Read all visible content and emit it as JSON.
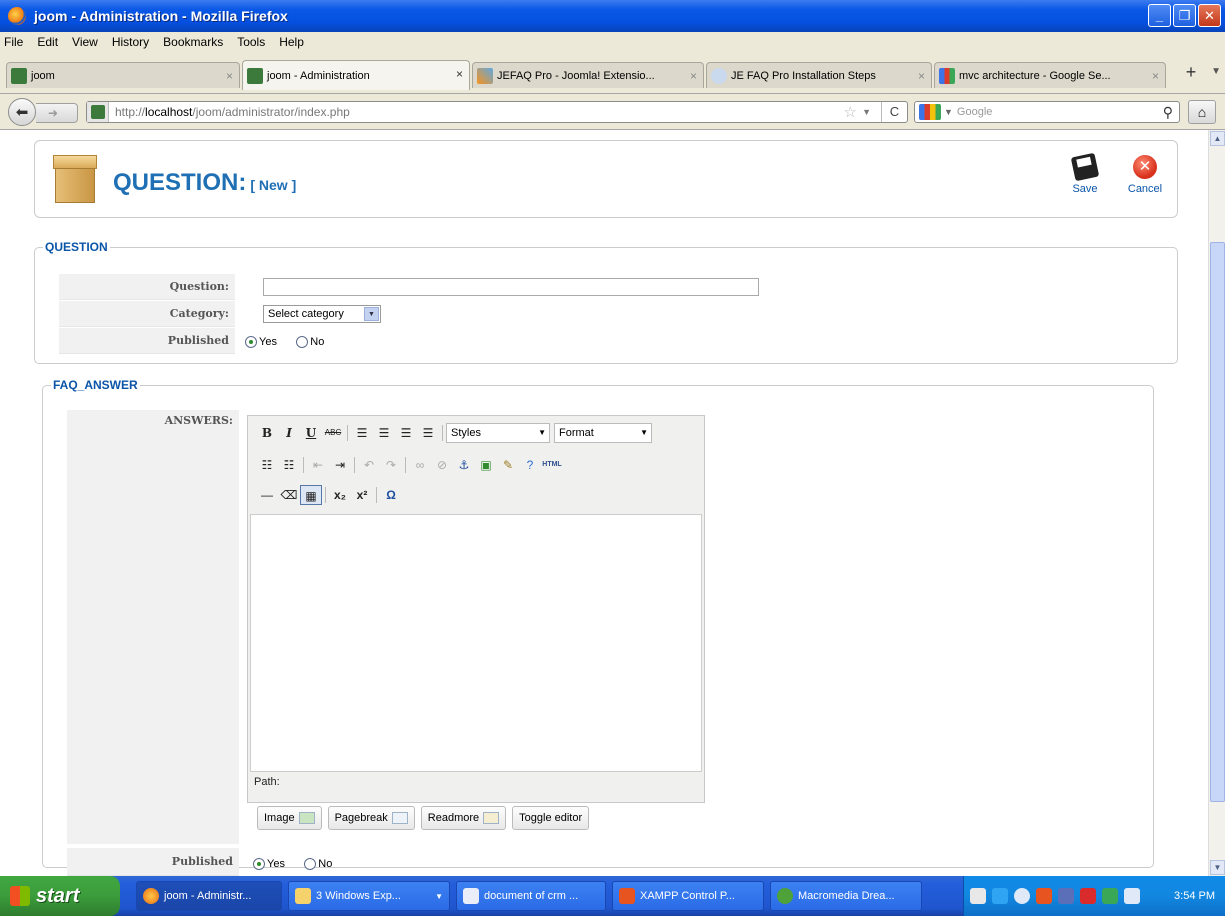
{
  "window": {
    "title": "joom - Administration - Mozilla Firefox"
  },
  "menu": [
    "File",
    "Edit",
    "View",
    "History",
    "Bookmarks",
    "Tools",
    "Help"
  ],
  "tabs": [
    {
      "label": "joom",
      "active": false
    },
    {
      "label": "joom - Administration",
      "active": true
    },
    {
      "label": "JEFAQ Pro - Joomla! Extensio...",
      "active": false
    },
    {
      "label": "JE FAQ Pro Installation Steps",
      "active": false
    },
    {
      "label": "mvc architecture - Google Se...",
      "active": false
    }
  ],
  "nav": {
    "url_prefix": "http://",
    "url_host": "localhost",
    "url_path": "/joom/administrator/index.php",
    "search_placeholder": "Google"
  },
  "page": {
    "title": "QUESTION:",
    "subtitle": "[ New ]",
    "save_label": "Save",
    "cancel_label": "Cancel"
  },
  "question_section": {
    "legend": "QUESTION",
    "question_label": "Question:",
    "question_value": "",
    "category_label": "Category:",
    "category_value": "Select category",
    "published_label": "Published",
    "yes_label": "Yes",
    "no_label": "No",
    "published_value": "Yes"
  },
  "answer_section": {
    "legend": "FAQ_ANSWER",
    "answers_label": "ANSWERS:",
    "styles_label": "Styles",
    "format_label": "Format",
    "html_label": "HTML",
    "path_label": "Path:",
    "buttons": {
      "image": "Image",
      "pagebreak": "Pagebreak",
      "readmore": "Readmore",
      "toggle": "Toggle editor"
    },
    "published_label": "Published",
    "yes_label": "Yes",
    "no_label": "No",
    "published_value": "Yes"
  },
  "taskbar": {
    "start_label": "start",
    "tasks": [
      "joom - Administr...",
      "3 Windows Exp...",
      "document of crm ...",
      "XAMPP Control P...",
      "Macromedia Drea..."
    ],
    "clock": "3:54 PM"
  }
}
